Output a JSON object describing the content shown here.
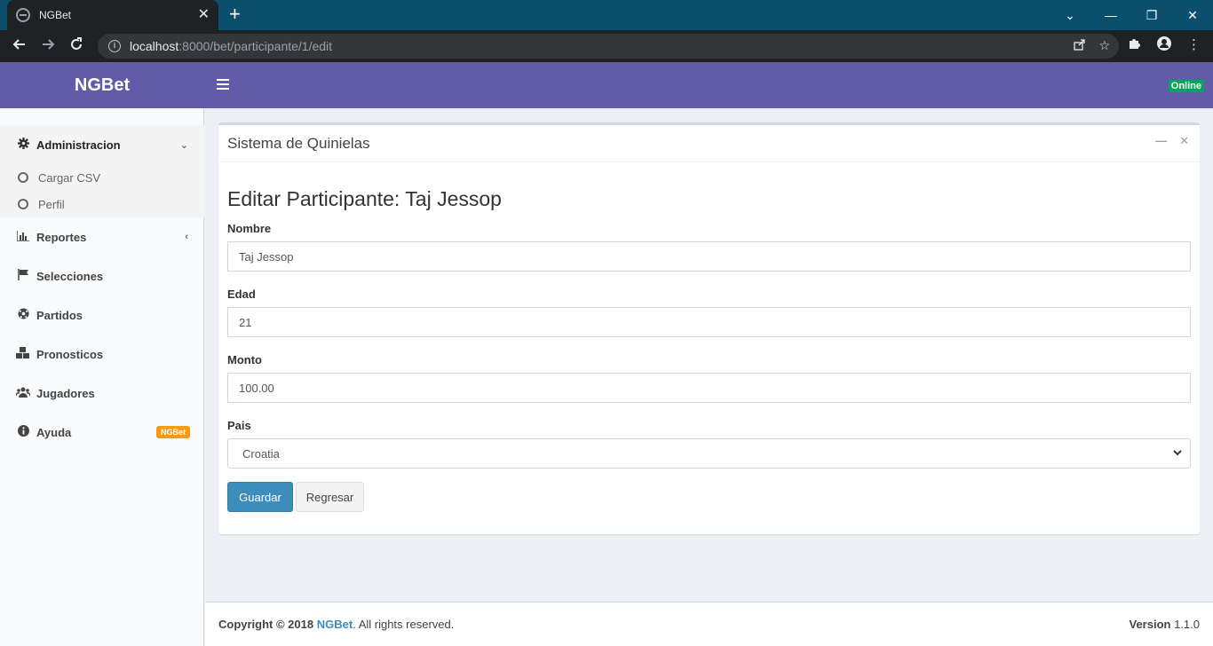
{
  "browser": {
    "tab_title": "NGBet",
    "tab_close": "✕",
    "new_tab": "+",
    "url_host": "localhost",
    "url_path": ":8000/bet/participante/1/edit",
    "window_controls": [
      "⌄",
      "—",
      "❐",
      "✕"
    ]
  },
  "header": {
    "logo": "NGBet",
    "status": "Online",
    "status_color": "#00a65a",
    "brand_color": "#605ca8"
  },
  "sidebar": {
    "items": [
      {
        "label": "Administracion",
        "icon": "gear-icon",
        "caret": "⌄"
      },
      {
        "label": "Reportes",
        "icon": "bar-chart-icon",
        "caret": "‹"
      },
      {
        "label": "Selecciones",
        "icon": "flag-icon"
      },
      {
        "label": "Partidos",
        "icon": "soccer-ball-icon"
      },
      {
        "label": "Pronosticos",
        "icon": "cubes-icon"
      },
      {
        "label": "Jugadores",
        "icon": "users-icon"
      },
      {
        "label": "Ayuda",
        "icon": "info-icon",
        "badge": "NGBet"
      }
    ],
    "submenu": [
      {
        "label": "Cargar CSV"
      },
      {
        "label": "Perfil"
      }
    ]
  },
  "box": {
    "title": "Sistema de Quinielas",
    "collapse_icon": "—",
    "close_icon": "✕"
  },
  "form": {
    "heading": "Editar Participante: Taj Jessop",
    "nombre_label": "Nombre",
    "nombre_value": "Taj Jessop",
    "edad_label": "Edad",
    "edad_value": "21",
    "monto_label": "Monto",
    "monto_value": "100.00",
    "pais_label": "Pais",
    "pais_value": "Croatia",
    "save_label": "Guardar",
    "back_label": "Regresar"
  },
  "footer": {
    "copyright_prefix": "Copyright © 2018",
    "brand": "NGBet",
    "copyright_suffix": ". All rights reserved.",
    "version_label": "Version",
    "version_value": "1.1.0"
  }
}
